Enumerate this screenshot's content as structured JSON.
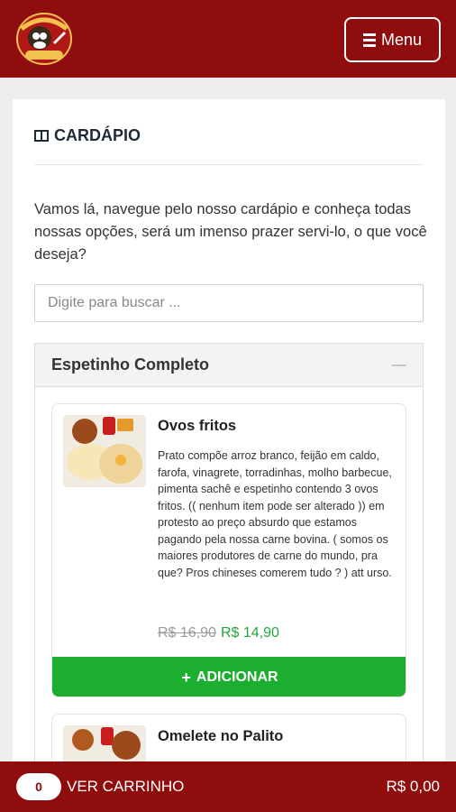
{
  "header": {
    "menu_label": "Menu",
    "logo_icon": "restaurant-logo"
  },
  "section": {
    "title": "CARDÁPIO",
    "intro": "Vamos lá, navegue pelo nosso cardápio e conheça todas nossas opções, será um imenso prazer servi-lo, o que você deseja?"
  },
  "search": {
    "placeholder": "Digite para buscar ..."
  },
  "category": {
    "title": "Espetinho Completo"
  },
  "products": [
    {
      "name": "Ovos fritos",
      "description": "Prato compõe arroz branco, feijão em caldo, farofa, vinagrete, torradinhas, molho barbecue, pimenta sachê e espetinho contendo 3 ovos fritos. (( nenhum item pode ser alterado )) em protesto ao preço absurdo que estamos pagando pela nossa carne bovina. ( somos os maiores produtores de carne do mundo, pra que? Pros chineses comerem tudo ? ) att urso.",
      "old_price": "R$ 16,90",
      "price": "R$ 14,90",
      "add_label": "ADICIONAR"
    },
    {
      "name": "Omelete no Palito"
    }
  ],
  "cart": {
    "count": "0",
    "label": "VER CARRINHO",
    "total": "R$ 0,00"
  },
  "colors": {
    "brand": "#8f0d0d",
    "add_button": "#1eae2f",
    "new_price": "#23a53a"
  }
}
